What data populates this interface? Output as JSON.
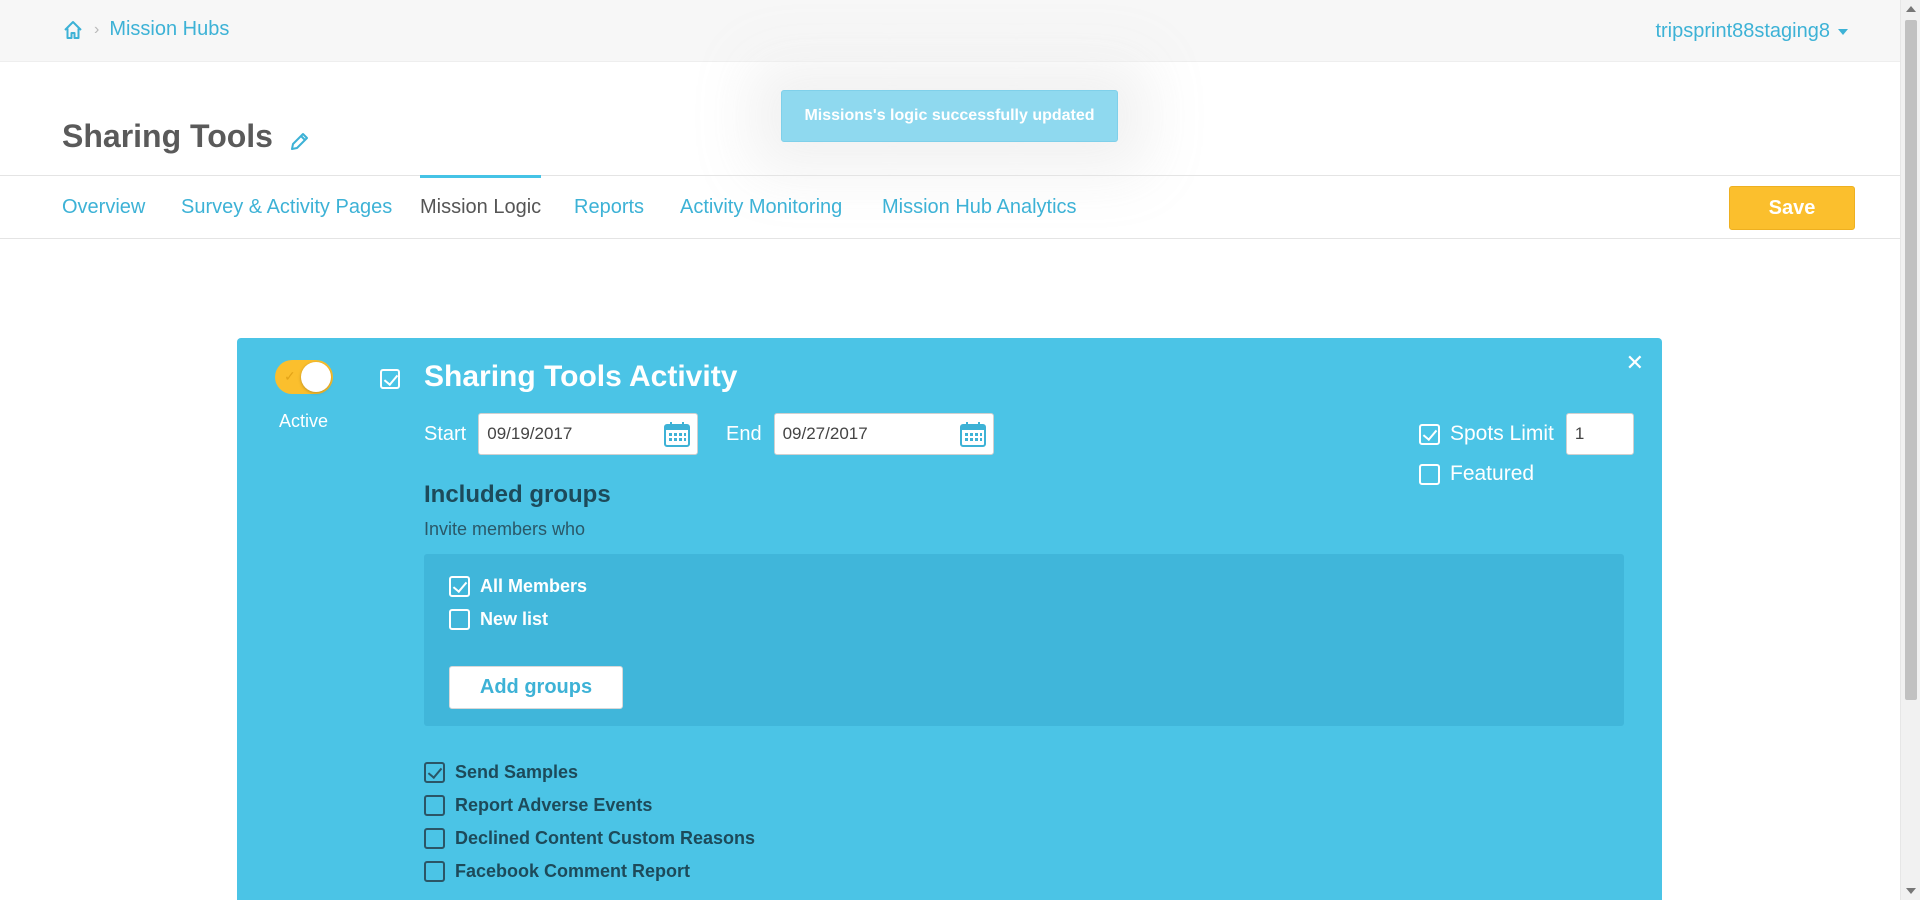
{
  "breadcrumb": {
    "home_icon": "home-icon",
    "items": [
      "Mission Hubs"
    ]
  },
  "account": {
    "name": "tripsprint88staging8"
  },
  "toast": {
    "message": "Missions's logic successfully updated"
  },
  "page": {
    "title": "Sharing Tools",
    "edit_icon": "pencil-icon"
  },
  "tabs": [
    {
      "label": "Overview",
      "active": false
    },
    {
      "label": "Survey & Activity Pages",
      "active": false
    },
    {
      "label": "Mission Logic",
      "active": true
    },
    {
      "label": "Reports",
      "active": false
    },
    {
      "label": "Activity Monitoring",
      "active": false
    },
    {
      "label": "Mission Hub Analytics",
      "active": false
    }
  ],
  "toolbar": {
    "save_label": "Save"
  },
  "activity": {
    "active_label": "Active",
    "active": true,
    "selected": true,
    "title": "Sharing Tools Activity",
    "start_label": "Start",
    "start_date": "09/19/2017",
    "end_label": "End",
    "end_date": "09/27/2017",
    "spots_limit_label": "Spots Limit",
    "spots_limit_checked": true,
    "spots_limit_value": "1",
    "featured_label": "Featured",
    "featured_checked": false,
    "groups_title": "Included groups",
    "groups_subtitle": "Invite members who",
    "groups": [
      {
        "label": "All Members",
        "checked": true
      },
      {
        "label": "New list",
        "checked": false
      }
    ],
    "add_groups_label": "Add groups",
    "options": [
      {
        "label": "Send Samples",
        "checked": true
      },
      {
        "label": "Report Adverse Events",
        "checked": false
      },
      {
        "label": "Declined Content Custom Reasons",
        "checked": false
      },
      {
        "label": "Facebook Comment Report",
        "checked": false
      }
    ]
  },
  "colors": {
    "accent": "#3db2d6",
    "panel": "#4bc4e6",
    "save": "#fbbf2d",
    "toast": "#8fd9ef"
  }
}
